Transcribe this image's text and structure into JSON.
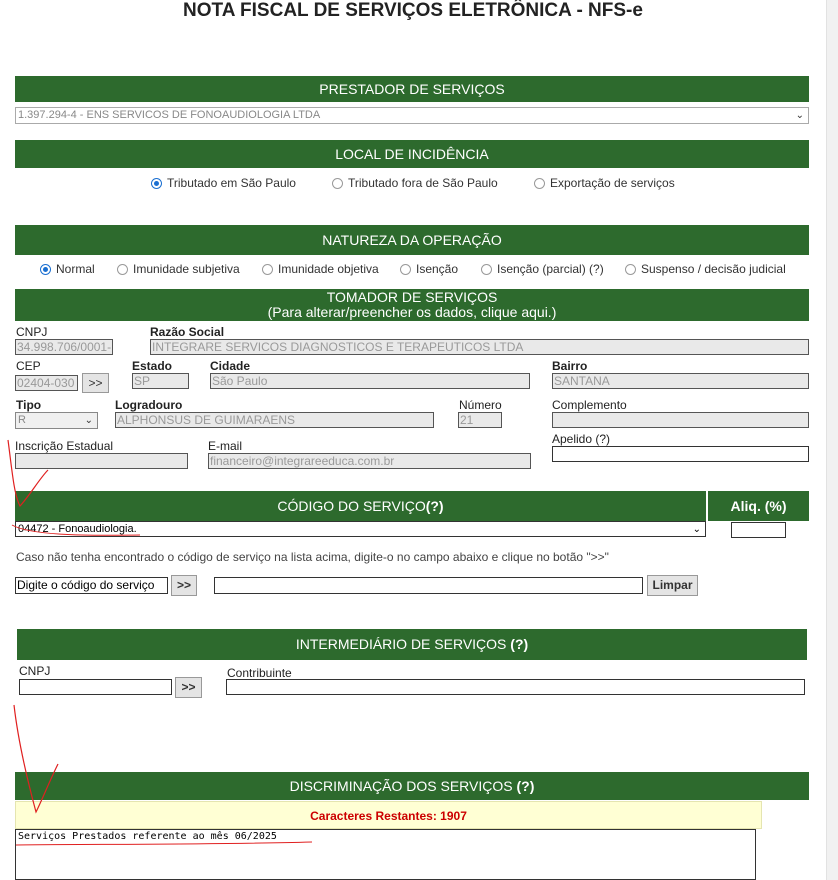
{
  "page": {
    "title": "NOTA FISCAL DE SERVIÇOS ELETRÔNICA - NFS-e"
  },
  "prestador": {
    "header": "PRESTADOR DE SERVIÇOS",
    "selected": "1.397.294-4 - ENS SERVICOS DE FONOAUDIOLOGIA LTDA"
  },
  "local": {
    "header": "LOCAL DE INCIDÊNCIA",
    "options": [
      {
        "label": "Tributado em São Paulo",
        "checked": true
      },
      {
        "label": "Tributado fora de São Paulo",
        "checked": false
      },
      {
        "label": "Exportação de serviços",
        "checked": false
      }
    ]
  },
  "natureza": {
    "header": "NATUREZA DA OPERAÇÃO",
    "options": [
      {
        "label": "Normal",
        "checked": true
      },
      {
        "label": "Imunidade subjetiva",
        "checked": false
      },
      {
        "label": "Imunidade objetiva",
        "checked": false
      },
      {
        "label": "Isenção",
        "checked": false
      },
      {
        "label": "Isenção (parcial) (?)",
        "checked": false
      },
      {
        "label": "Suspenso / decisão judicial",
        "checked": false
      }
    ]
  },
  "tomador": {
    "header": "TOMADOR DE SERVIÇOS",
    "subheader": "(Para alterar/preencher os dados, clique aqui.)",
    "cnpj_label": "CNPJ",
    "cnpj": "34.998.706/0001-",
    "razao_label": "Razão Social",
    "razao": "INTEGRARE SERVICOS DIAGNOSTICOS E TERAPEUTICOS LTDA",
    "cep_label": "CEP",
    "cep": "02404-030",
    "cep_button": ">>",
    "estado_label": "Estado",
    "estado": "SP",
    "cidade_label": "Cidade",
    "cidade": "São Paulo",
    "bairro_label": "Bairro",
    "bairro": "SANTANA",
    "tipo_label": "Tipo",
    "tipo": "R",
    "logradouro_label": "Logradouro",
    "logradouro": "ALPHONSUS DE GUIMARAENS",
    "numero_label": "Número",
    "numero": "21",
    "complemento_label": "Complemento",
    "complemento": "",
    "insc_label": "Inscrição Estadual",
    "insc": "",
    "email_label": "E-mail",
    "email": "financeiro@integrareeduca.com.br",
    "apelido_label": "Apelido (?)",
    "apelido": ""
  },
  "codigo": {
    "header_prefix": "CÓDIGO DO SERVIÇO",
    "header_help": "(?)",
    "aliq_header": "Aliq. (%)",
    "selected": "04472 - Fonoaudiologia.",
    "aliq_value": "",
    "hint": "Caso não tenha encontrado o código de serviço na lista acima, digite-o no campo abaixo e clique no botão \">>\"",
    "input_value": "Digite o código do serviço",
    "go_button": ">>",
    "search_value": "",
    "clear_button": "Limpar"
  },
  "intermediario": {
    "header_prefix": "INTERMEDIÁRIO DE SERVIÇOS",
    "header_help": "(?)",
    "cnpj_label": "CNPJ",
    "cnpj": "",
    "go_button": ">>",
    "contribuinte_label": "Contribuinte",
    "contribuinte": ""
  },
  "discriminacao": {
    "header_prefix": "DISCRIMINAÇÃO DOS SERVIÇOS",
    "header_help": "(?)",
    "remaining": "Caracteres Restantes: 1907",
    "text": "Serviços Prestados referente ao mês 06/2025"
  },
  "colors": {
    "header_green": "#2d6a2d",
    "radio_blue": "#1a6fd1",
    "warning_red": "#cc0000",
    "annotation_red": "#e02020"
  },
  "icons": {
    "select_chevron": "chevron-down-icon",
    "radio": "radio-icon"
  }
}
